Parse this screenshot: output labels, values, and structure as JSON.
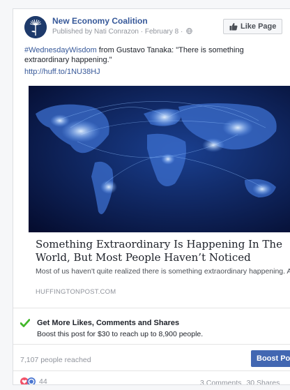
{
  "post": {
    "page_name": "New Economy Coalition",
    "published_by": "Published by Nati Conrazon",
    "date": "February 8",
    "like_page_label": "Like Page",
    "text_hashtag": "#WednesdayWisdom",
    "text_body": " from Gustavo Tanaka: \"There is something extraordinary happening.\"",
    "link_url": "http://huff.to/1NU38HJ"
  },
  "link_preview": {
    "title": "Something Extraordinary Is Happening In The World, But Most People Haven’t Noticed",
    "description": "Most of us haven't quite realized there is something extraordinary happening. A few months ago, I freed myself from standard-procedure...",
    "domain": "HUFFINGTONPOST.COM",
    "image": "world-map-night-lights"
  },
  "boost": {
    "title": "Get More Likes, Comments and Shares",
    "subtitle": "Boost this post for $30 to reach up to 8,900 people.",
    "reach": "7,107 people reached",
    "button_label": "Boost Post"
  },
  "engagement": {
    "reaction_count": "44",
    "comments": "3 Comments",
    "shares": "30 Shares"
  },
  "icons": {
    "avatar": "dandelion-logo",
    "privacy": "globe-icon",
    "like": "thumbs-up-icon",
    "check": "check-icon",
    "reactions": [
      "love-reaction-icon",
      "wow-reaction-icon"
    ],
    "help": "question-icon"
  },
  "colors": {
    "link_blue": "#365899",
    "button_blue": "#4267b2",
    "check_green": "#42b72a",
    "love_red": "#f25268",
    "meta_gray": "#90949c"
  }
}
